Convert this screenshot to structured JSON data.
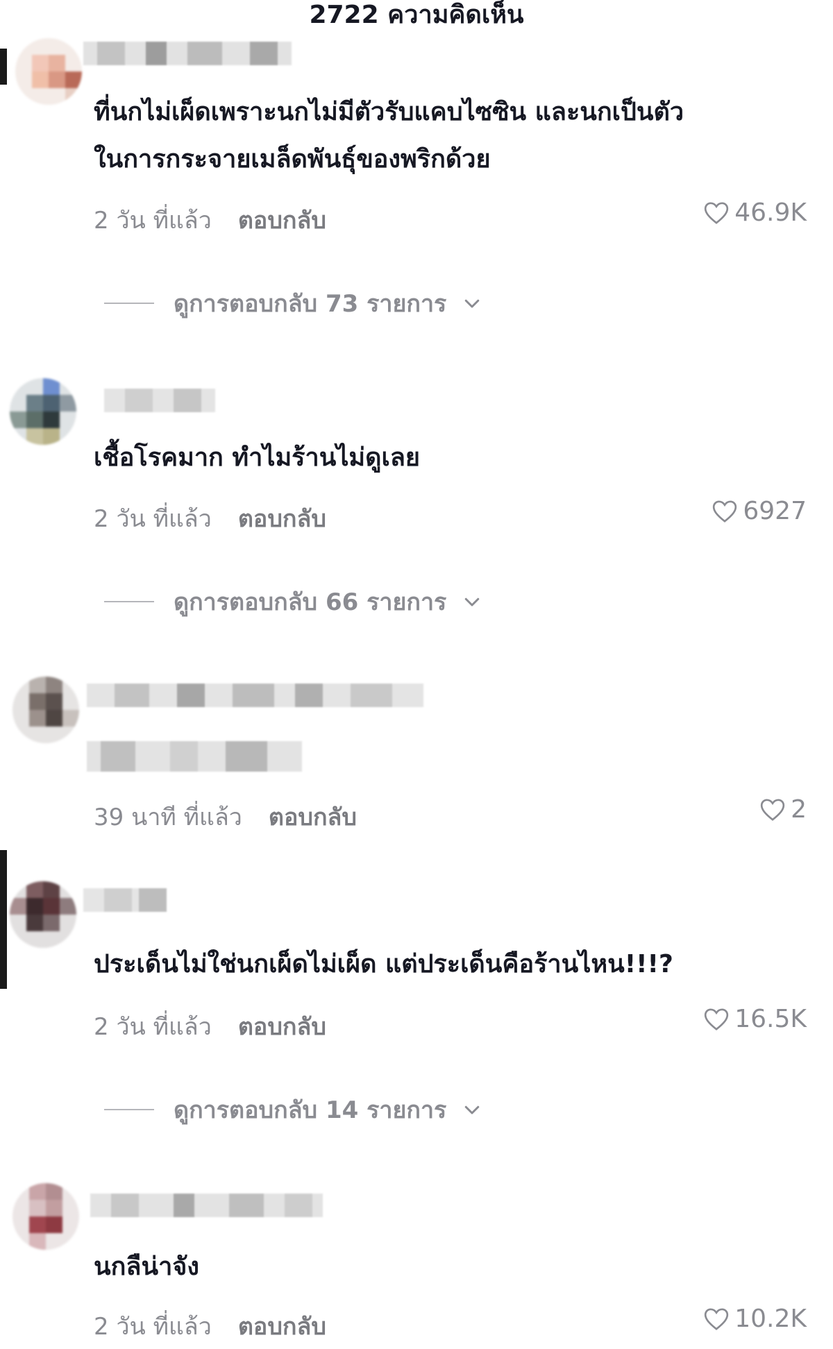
{
  "header": {
    "comment_count_label": "2722 ความคิดเห็น"
  },
  "comments": [
    {
      "text_line1": "ที่นกไม่เผ็ดเพราะนกไม่มีตัวรับแคบไซซิน และนกเป็นตัว",
      "text_line2": "ในการกระจายเมล็ดพันธุ์ของพริกด้วย",
      "time": "2 วัน ที่แล้ว",
      "reply_label": "ตอบกลับ",
      "likes": "46.9K",
      "view_replies": "ดูการตอบกลับ 73 รายการ"
    },
    {
      "text_line1": "เชื้อโรคมาก ทำไมร้านไม่ดูเลย",
      "time": "2 วัน ที่แล้ว",
      "reply_label": "ตอบกลับ",
      "likes": "6927",
      "view_replies": "ดูการตอบกลับ 66 รายการ"
    },
    {
      "text_line1": "",
      "time": "39 นาที ที่แล้ว",
      "reply_label": "ตอบกลับ",
      "likes": "2"
    },
    {
      "text_line1": "ประเด็นไม่ใช่นกเผ็ดไม่เผ็ด แต่ประเด็นคือร้านไหน!!!?",
      "time": "2 วัน ที่แล้ว",
      "reply_label": "ตอบกลับ",
      "likes": "16.5K",
      "view_replies": "ดูการตอบกลับ 14 รายการ"
    },
    {
      "text_line1": "นกลืน่าจัง",
      "time": "2 วัน ที่แล้ว",
      "reply_label": "ตอบกลับ",
      "likes": "10.2K"
    }
  ],
  "icons": {
    "like": "heart-outline-icon",
    "expand": "chevron-down-icon"
  },
  "colors": {
    "text_primary": "#161823",
    "text_secondary": "#8a8b91"
  }
}
